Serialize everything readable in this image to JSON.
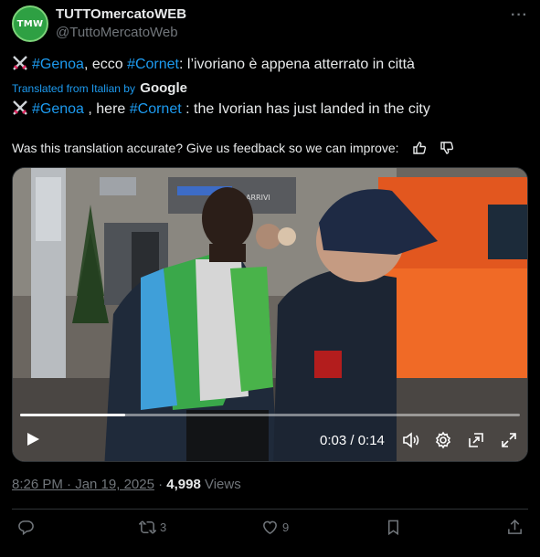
{
  "author": {
    "avatar_text": "TMW",
    "display_name": "TUTTOmercatoWEB",
    "handle": "@TuttoMercatoWeb",
    "more_icon": "more-icon"
  },
  "tweet": {
    "original": {
      "tag1": "#Genoa",
      "mid": ", ecco ",
      "tag2": "#Cornet",
      "rest": ": l’ivoriano è appena atterrato in città"
    },
    "translated_label": "Translated from Italian by",
    "translator": "Google",
    "translation": {
      "tag1": "#Genoa",
      "mid": " , here ",
      "tag2": "#Cornet",
      "rest": " : the Ivorian has just landed in the city"
    },
    "feedback": "Was this translation accurate? Give us feedback so we can improve:"
  },
  "video": {
    "progress_fraction": 0.21,
    "time": "0:03 / 0:14",
    "signage_arrivi": "ARRIVI",
    "controls": [
      "play-icon",
      "volume-icon",
      "settings-icon",
      "pip-icon",
      "fullscreen-icon"
    ]
  },
  "meta": {
    "time": "8:26 PM · Jan 19, 2025",
    "separator": " · ",
    "views_count": "4,998",
    "views_label": " Views"
  },
  "actions": {
    "reply_count": "",
    "retweet_count": "3",
    "like_count": "9"
  },
  "colors": {
    "accent": "#1d9bf0",
    "muted": "#71767b",
    "background": "#000000"
  }
}
